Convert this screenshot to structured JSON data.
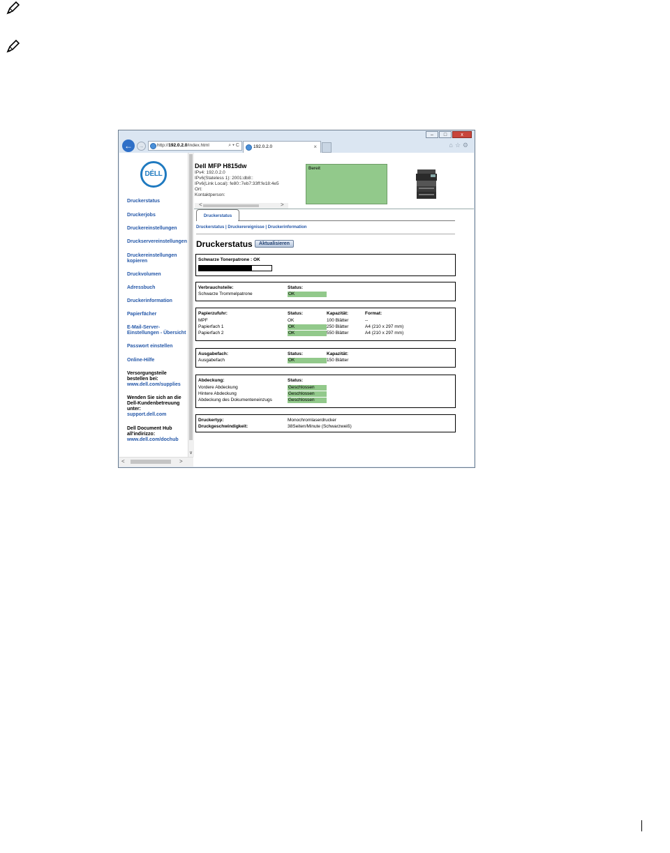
{
  "browser": {
    "url_prefix": "http://",
    "url_host": "192.0.2.0",
    "url_path": "/index.html",
    "addr_tools": "⌕ ▾ C",
    "tab_title": "192.0.2.0",
    "tab_close": "×",
    "back_icon": "←",
    "forward_icon": "→",
    "nav_icons": "⌂☆⚙",
    "win_min": "–",
    "win_max": "□",
    "win_close": "x"
  },
  "sidebar": {
    "logo": "DÉLL",
    "items": [
      {
        "label": "Druckerstatus"
      },
      {
        "label": "Druckerjobs"
      },
      {
        "label": "Druckereinstellungen"
      },
      {
        "label": "Druckservereinstellungen"
      },
      {
        "label": "Druckereinstellungen"
      },
      {
        "label": "kopieren"
      },
      {
        "label": "Druckvolumen"
      },
      {
        "label": "Adressbuch"
      },
      {
        "label": "Druckerinformation"
      },
      {
        "label": "Papierfächer"
      },
      {
        "label": "E-Mail-Server-"
      },
      {
        "label": "Einstellungen - Übersicht"
      },
      {
        "label": "Passwort einstellen"
      },
      {
        "label": "Online-Hilfe"
      }
    ],
    "supplies_text_1": "Versorgungsteile",
    "supplies_text_2": "bestellen bei:",
    "supplies_link": "www.dell.com/supplies",
    "support_text_1": "Wenden Sie sich an die",
    "support_text_2": "Dell-Kundenbetreuung",
    "support_text_3": "unter:",
    "support_link": "support.dell.com",
    "dochub_text_1": "Dell Document Hub",
    "dochub_text_2": "all'indirizzo:",
    "dochub_link": "www.dell.com/dochub",
    "scroll_down": "∨",
    "scroll_left": "<",
    "scroll_right": ">"
  },
  "device": {
    "name": "Dell MFP H815dw",
    "ipv4": "IPv4: 192.0.2.0",
    "ipv6_stateless": "IPv6(Stateless 1): 2001:db8::",
    "ipv6_link": "IPv6(Link Local): fe80::7eb7:33ff:fe18:4e5",
    "location": "Ort:",
    "contact": "Kontaktperson:",
    "status": "Bereit",
    "scroll_left": "<",
    "scroll_right": ">"
  },
  "tabs": {
    "active": "Druckerstatus",
    "sublinks": "Druckerstatus | Druckerereignisse | Druckerinformation"
  },
  "page": {
    "title": "Druckerstatus -",
    "refresh_button": "Aktualisieren"
  },
  "toner": {
    "label": "Schwarze Tonerpatrone : OK",
    "level": 0.73
  },
  "consumables": {
    "header": "Verbrauchsteile:",
    "status_header": "Status:",
    "rows": [
      {
        "name": "Schwarze Trommelpatrone",
        "status": "OK"
      }
    ]
  },
  "trays": {
    "header": "Papierzufuhr:",
    "status_header": "Status:",
    "capacity_header": "Kapazität:",
    "format_header": "Format:",
    "rows": [
      {
        "name": "MPF",
        "status": "OK",
        "capacity": "100 Blätter",
        "format": "--"
      },
      {
        "name": "Papierfach 1",
        "status": "OK",
        "capacity": "250 Blätter",
        "format": "A4 (210 x 297 mm)"
      },
      {
        "name": "Papierfach 2",
        "status": "OK",
        "capacity": "550 Blätter",
        "format": "A4 (210 x 297 mm)"
      }
    ]
  },
  "output": {
    "header": "Ausgabefach:",
    "status_header": "Status:",
    "capacity_header": "Kapazität:",
    "rows": [
      {
        "name": "Ausgabefach",
        "status": "OK",
        "capacity": "150 Blätter"
      }
    ]
  },
  "covers": {
    "header": "Abdeckung:",
    "status_header": "Status:",
    "rows": [
      {
        "name": "Vordere Abdeckung",
        "status": "Geschlossen"
      },
      {
        "name": "Hintere Abdeckung",
        "status": "Geschlossen"
      },
      {
        "name": "Abdeckung des Dokumenteneinzugs",
        "status": "Geschlossen"
      }
    ]
  },
  "printer_info": {
    "type_label": "Druckertyp:",
    "type_value": "Monochromlaserdrucker",
    "speed_label": "Druckgeschwindigkeit:",
    "speed_value": "38Seiten/Minute (Schwarzweiß)"
  },
  "colors": {
    "ok_green": "#92c98b",
    "link_blue": "#2457a8",
    "dell_blue": "#1f7ac0"
  }
}
